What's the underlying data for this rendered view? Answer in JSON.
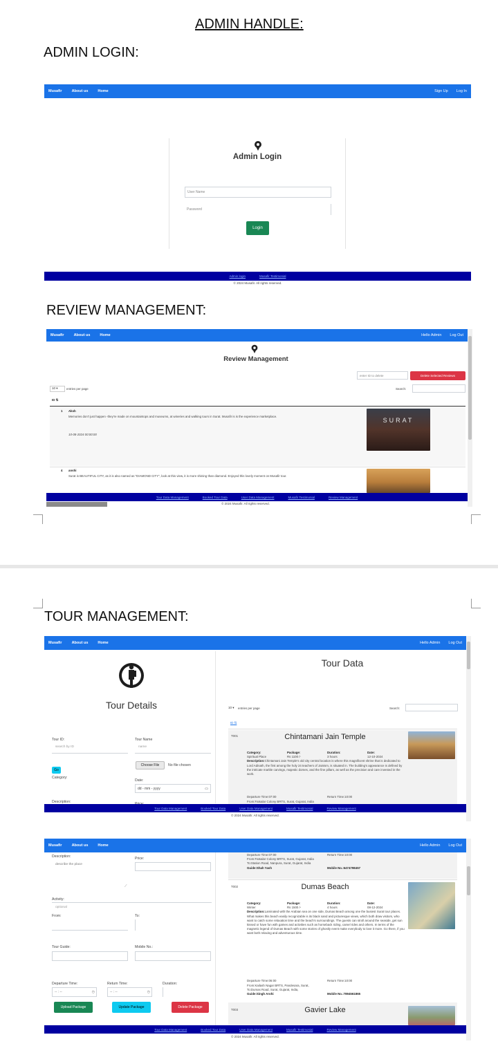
{
  "document": {
    "title": "ADMIN HANDLE:",
    "section_admin_login": "ADMIN LOGIN:",
    "section_review": "REVIEW MANAGEMENT:",
    "section_tour": "TOUR MANAGEMENT:"
  },
  "nav": {
    "brand": "Musafir",
    "about": "About us",
    "home": "Home",
    "signup": "Sign Up",
    "login": "Log In",
    "hello_admin": "Hello Admin",
    "logout": "Log Out"
  },
  "login": {
    "title": "Admin Login",
    "username_placeholder": "User Name",
    "password_placeholder": "Password",
    "login_button": "Login",
    "footer_link1": "Admin login",
    "footer_link2": "Musafir Testimonial",
    "copyright": "© 2024 Musafir. All rights reserved."
  },
  "footer_links": {
    "tour_data": "Tour Data Management",
    "booked": "Booked Tour Data",
    "user": "User Data Management",
    "testimonial": "Musafir Testimonial",
    "review": "Review Management",
    "copyright": "© 2024 Musafir. All rights reserved."
  },
  "review": {
    "title": "Review Management",
    "delete_placeholder": "enter ID to delete",
    "delete_button": "Delete Selected Reviews",
    "entries_value": "10",
    "entries_label": "entries per page",
    "search_label": "Search:",
    "id_header": "ID",
    "rows": [
      {
        "id": "1",
        "name": "Aksh",
        "text": "Memories don't just happen -they're made on mountaintops and museums, at wineries and walking tours in Surat. Musafir is is the experience marketplace.",
        "date": "10-08-2024 00:00:00",
        "image_label": "SURAT"
      },
      {
        "id": "4",
        "name": "anshi",
        "text": "Surat is BEAUTIFUL CITY, as it is also named as \"DIAMOND CITY\", look at this view, it is more shining than diamond. Enjoyed this lovely moment on Musafir tour."
      }
    ]
  },
  "tour": {
    "details_title": "Tour Details",
    "data_title": "Tour Data",
    "tour_id_label": "Tour ID:",
    "tour_id_placeholder": "search by ID",
    "tour_name_label": "Tour Name",
    "tour_name_placeholder": "name",
    "go_button": "Go",
    "choose_file": "Choose File",
    "no_file": "No file chosen",
    "category_label": "Category:",
    "date_label": "Date:",
    "date_placeholder": "dd - mm - yyyy",
    "description_label": "Description:",
    "description_placeholder": "describe the place",
    "price_label": "Price:",
    "activity_label": "Activity:",
    "activity_placeholder": "optional",
    "from_label": "From:",
    "to_label": "To:",
    "guide_label": "Tour Guide:",
    "mobile_label": "Mobile No.:",
    "departure_label": "Departure Time:",
    "return_label": "Return Time:",
    "duration_label": "Duration:",
    "time_placeholder": "-- : --",
    "upload_button": "Upload Package",
    "update_button": "Update Package",
    "delete_button": "Delete Package",
    "entries_value": "10",
    "entries_label": "entries per page",
    "search_label": "Search:",
    "id_header": "ID",
    "records": [
      {
        "id": "T001",
        "name": "Chintamani Jain Temple",
        "category_label": "Category:",
        "category": "Spiritual Place",
        "package_label": "Package:",
        "package": "Rs 1100 /-",
        "duration_label": "Duration:",
        "duration": "3 hours",
        "date_label": "Date:",
        "date": "12-10-2024",
        "description_label": "Description:",
        "description": "Chintamani Jain Temple's old city central location is where this magnificent shrine that is dedicated to Lord Adinath, the first among the holy 24 teachers of Jainism, is situated in. The building's appearance is defined by the intricate marble carvings, majestic domes, and the fine pillars, as well as the precision and care invested in the work.",
        "departure": "Departure Time:07:00",
        "return": "Return Time:10:00",
        "from": "From:Fatsalar Colony BRTS, Surat, Gujarat, India",
        "to": "To:Station Road, Nanpura, Surat, Gujarat, India",
        "guide": "Guide:Shah Yash",
        "mobile": "Mobile No.:6474798457"
      },
      {
        "id": "T002",
        "name": "Dumas Beach",
        "category_label": "Category:",
        "category": "Winter",
        "package_label": "Package:",
        "package": "Rs 1500 /-",
        "duration_label": "Duration:",
        "duration": "4 hours",
        "date_label": "Date:",
        "date": "08-12-2024",
        "description_label": "Description:",
        "description": "Laminated with the Arabian sea on one side, Dumas Beach among one the busiest Surat tour places. What makes this beach easily recognizable is its black sand and picturesque views, which both draw visitors, who want to catch some relaxation time and the beach's surroundings. The guests can stroll around the seaside, get sun kissed or have fun with games and activities such as horseback riding, camel rides and others. In terms of the magnetic legend of Dumas Beach with some stories of ghostly event make everybody to love it more. Go there, if you want both relaxing and adventurous time.",
        "departure": "Departure Time:06:00",
        "return": "Return Time:10:00",
        "from": "From:Kailash Nagar BRTS, Pandesara, Surat,",
        "to": "To:Dumas Road, Surat, Gujarat, India,",
        "guide": "Guide:Singh Arohi",
        "mobile": "Mobile No.:7894561865"
      },
      {
        "id": "T003",
        "name": "Gavier Lake"
      }
    ]
  }
}
